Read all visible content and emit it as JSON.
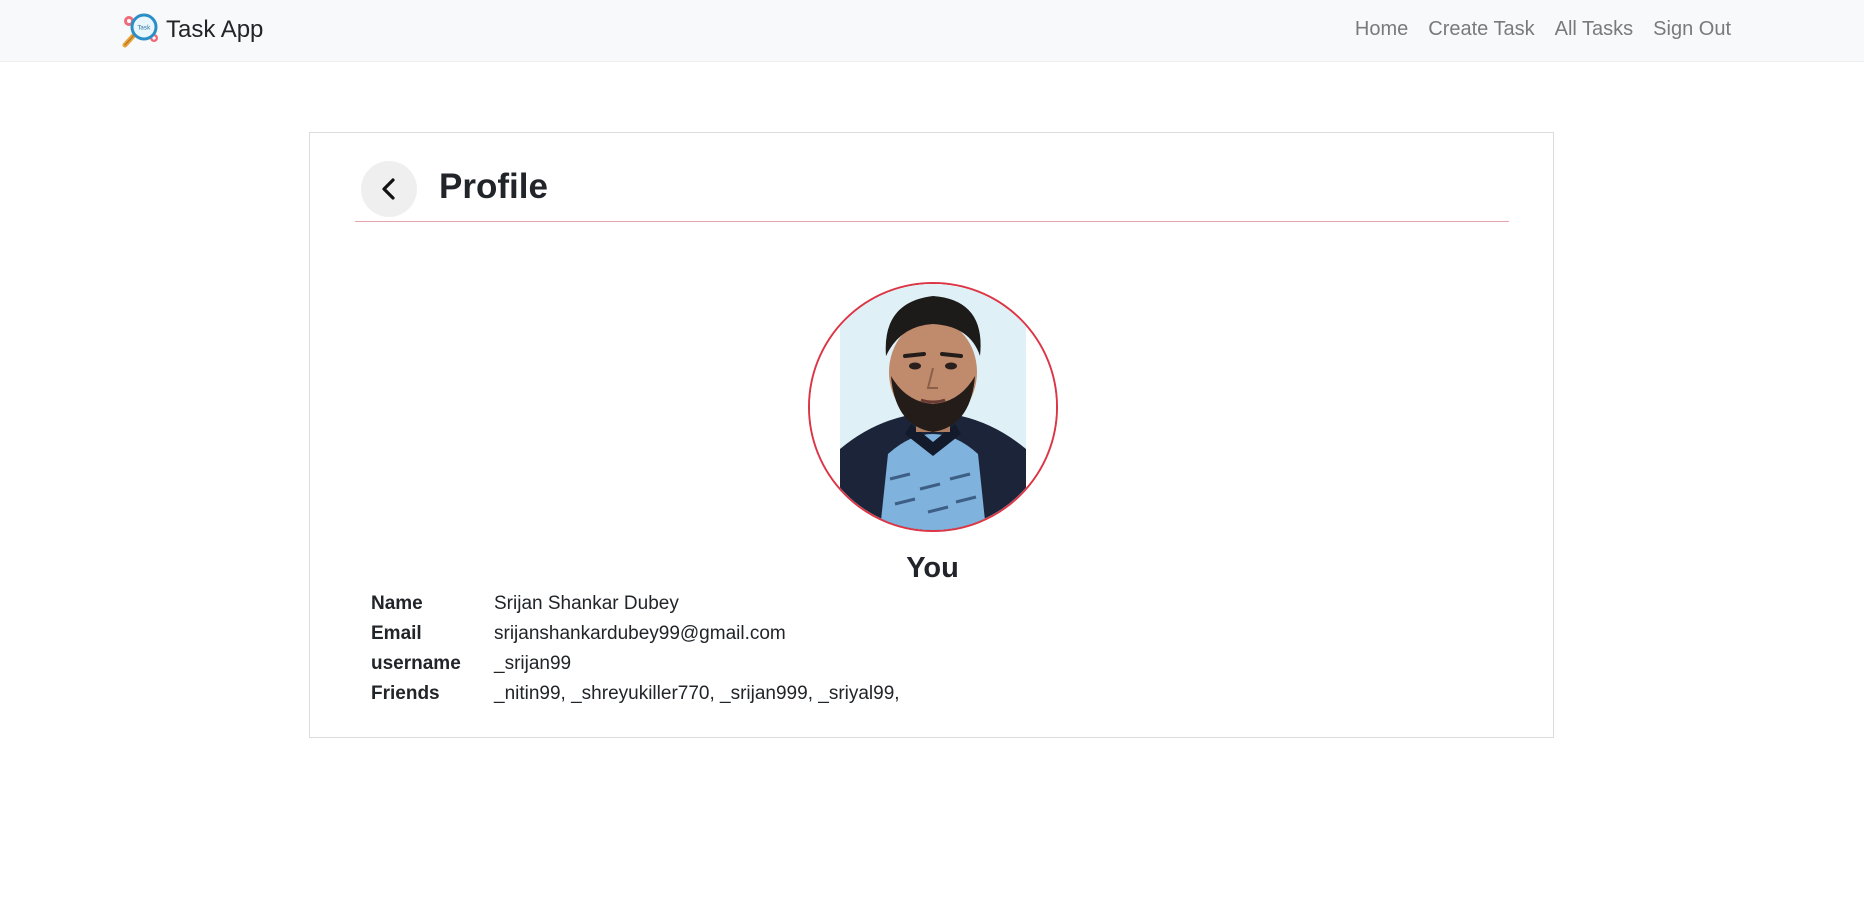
{
  "navbar": {
    "brand": "Task App",
    "logo_icon": "task-magnifier-logo",
    "links": [
      "Home",
      "Create Task",
      "All Tasks",
      "Sign Out"
    ]
  },
  "profile": {
    "title": "Profile",
    "back_icon": "chevron-left-icon",
    "avatar_label": "You",
    "details": [
      {
        "label": "Name",
        "value": "Srijan Shankar Dubey"
      },
      {
        "label": "Email",
        "value": "srijanshankardubey99@gmail.com"
      },
      {
        "label": "username",
        "value": "_srijan99"
      },
      {
        "label": "Friends",
        "value": "_nitin99, _shreyukiller770, _srijan999, _sriyal99,"
      }
    ]
  },
  "colors": {
    "navbar_bg": "#f8f9fa",
    "accent": "#dc3545",
    "header_divider": "#e8a3ad",
    "back_button_bg": "#efefef"
  }
}
